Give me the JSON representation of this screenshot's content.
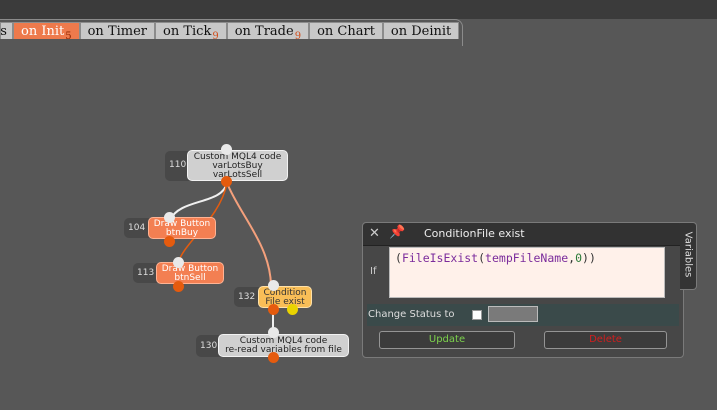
{
  "tabs": [
    {
      "label": "ts",
      "count": ""
    },
    {
      "label": "on Init",
      "count": "5"
    },
    {
      "label": "on Timer",
      "count": ""
    },
    {
      "label": "on Tick",
      "count": "9"
    },
    {
      "label": "on Trade",
      "count": "9"
    },
    {
      "label": "on Chart",
      "count": ""
    },
    {
      "label": "on Deinit",
      "count": ""
    }
  ],
  "nodes": [
    {
      "id": "110",
      "line1": "Custom MQL4 code",
      "line2": "varLotsBuy",
      "line3": "varLotsSell"
    },
    {
      "id": "104",
      "line1": "Draw Button",
      "line2": "btnBuy"
    },
    {
      "id": "113",
      "line1": "Draw Button",
      "line2": "btnSell"
    },
    {
      "id": "132",
      "line1": "Condition",
      "line2": "File exist"
    },
    {
      "id": "130",
      "line1": "Custom MQL4 code",
      "line2": "re-read variables from file"
    }
  ],
  "popup": {
    "title": "ConditionFile exist",
    "if_label": "If",
    "code": {
      "open": "(",
      "func": "FileIsExist",
      "args_open": "(",
      "var": "tempFileName",
      "comma": ",",
      "arg2": "0",
      "close": "))"
    },
    "status_label": "Change Status to",
    "update_label": "Update",
    "delete_label": "Delete"
  },
  "side_tab": {
    "label": "Variables"
  },
  "colors": {
    "active_tab": "#ee7a4c",
    "node_orange": "#f37f52",
    "node_yellow": "#f9be57",
    "node_grey": "#d0d0d0",
    "update_text": "#7cd24c",
    "delete_text": "#d21e1e"
  }
}
